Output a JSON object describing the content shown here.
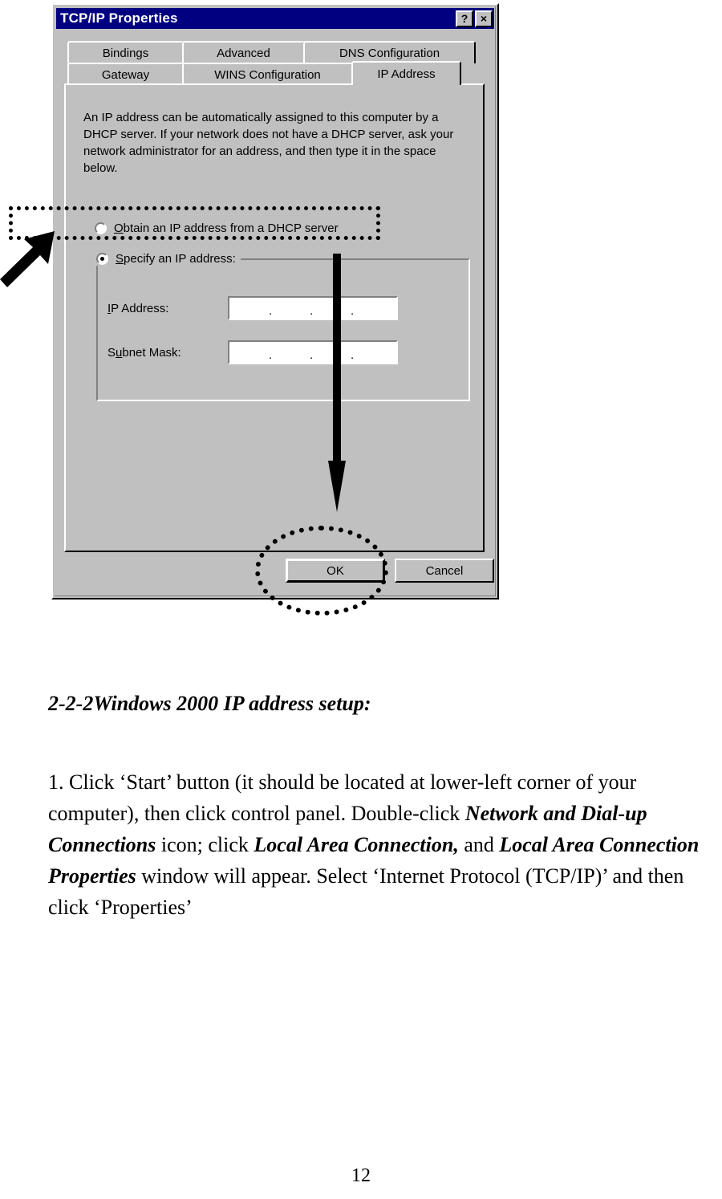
{
  "dialog": {
    "title": "TCP/IP Properties",
    "help_button": "?",
    "close_button": "×",
    "tabs_row1": [
      {
        "label": "Bindings",
        "active": false
      },
      {
        "label": "Advanced",
        "active": false
      },
      {
        "label": "DNS Configuration",
        "active": false
      }
    ],
    "tabs_row2": [
      {
        "label": "Gateway",
        "active": false
      },
      {
        "label": "WINS Configuration",
        "active": false
      },
      {
        "label": "IP Address",
        "active": true
      }
    ],
    "description": "An IP address can be automatically assigned to this computer by a DHCP server. If your network does not have a DHCP server, ask your network administrator for an address, and then type it in the space below.",
    "option_dhcp": {
      "label": "Obtain an IP address from a DHCP server",
      "selected": false
    },
    "option_specify": {
      "label": "Specify an IP address:",
      "selected": true
    },
    "fields": [
      {
        "label": "IP Address:",
        "value": "",
        "separator": "."
      },
      {
        "label": "Subnet Mask:",
        "value": "",
        "separator": "."
      }
    ],
    "buttons": {
      "ok": "OK",
      "cancel": "Cancel"
    }
  },
  "document": {
    "heading": "2-2-2Windows 2000 IP address setup:",
    "paragraph": {
      "part1": "1. Click ‘Start’ button (it should be located at lower-left corner of your computer), then click control panel. Double-click ",
      "bold1": "Network and Dial-up Connections",
      "part2": " icon; click ",
      "bold2": "Local Area Connection,",
      "part3": " and ",
      "bold3": "Local Area Connection Properties",
      "part4": " window will appear. Select ‘Internet Protocol (TCP/IP)’ and then click ‘Properties’"
    },
    "page_number": "12"
  },
  "annotations": {
    "dhcp_highlight": "dotted-rectangle",
    "ok_highlight": "dotted-ellipse",
    "pointer_arrow": "black-arrow-up-right",
    "flow_arrow": "black-arrow-down"
  },
  "colors": {
    "titlebar": "#000080",
    "dialog_face": "#c0c0c0",
    "annotation": "#000000"
  }
}
